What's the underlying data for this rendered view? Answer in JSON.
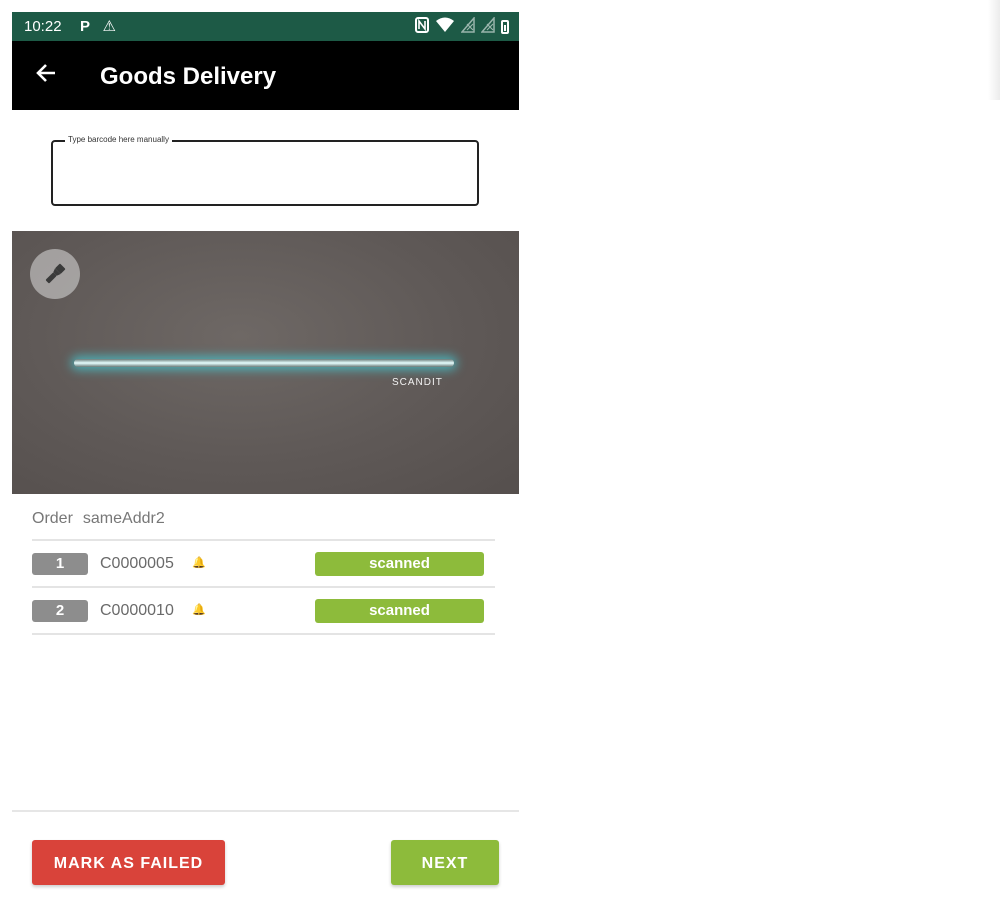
{
  "status_bar": {
    "time": "10:22",
    "left_icons": [
      "parking-icon",
      "warning-icon"
    ],
    "right_icons": [
      "nfc-icon",
      "wifi-icon",
      "signal-off-icon",
      "signal-off-icon",
      "battery-icon"
    ]
  },
  "app_bar": {
    "title": "Goods Delivery",
    "back_icon": "arrow-left-icon"
  },
  "barcode_input": {
    "label": "Type barcode here manually",
    "value": ""
  },
  "camera": {
    "torch_icon": "flashlight-icon",
    "logo": "SCANDIT"
  },
  "order": {
    "label": "Order",
    "id": "sameAddr2",
    "items": [
      {
        "index": "1",
        "code": "C0000005",
        "status": "scanned"
      },
      {
        "index": "2",
        "code": "C0000010",
        "status": "scanned"
      }
    ]
  },
  "actions": {
    "mark_failed": "MARK AS FAILED",
    "next": "NEXT"
  },
  "colors": {
    "status_bar": "#1d5a46",
    "app_bar": "#000000",
    "scanned_badge": "#8dbb3b",
    "failed_button": "#d9433a",
    "next_button": "#8dbb3b"
  }
}
